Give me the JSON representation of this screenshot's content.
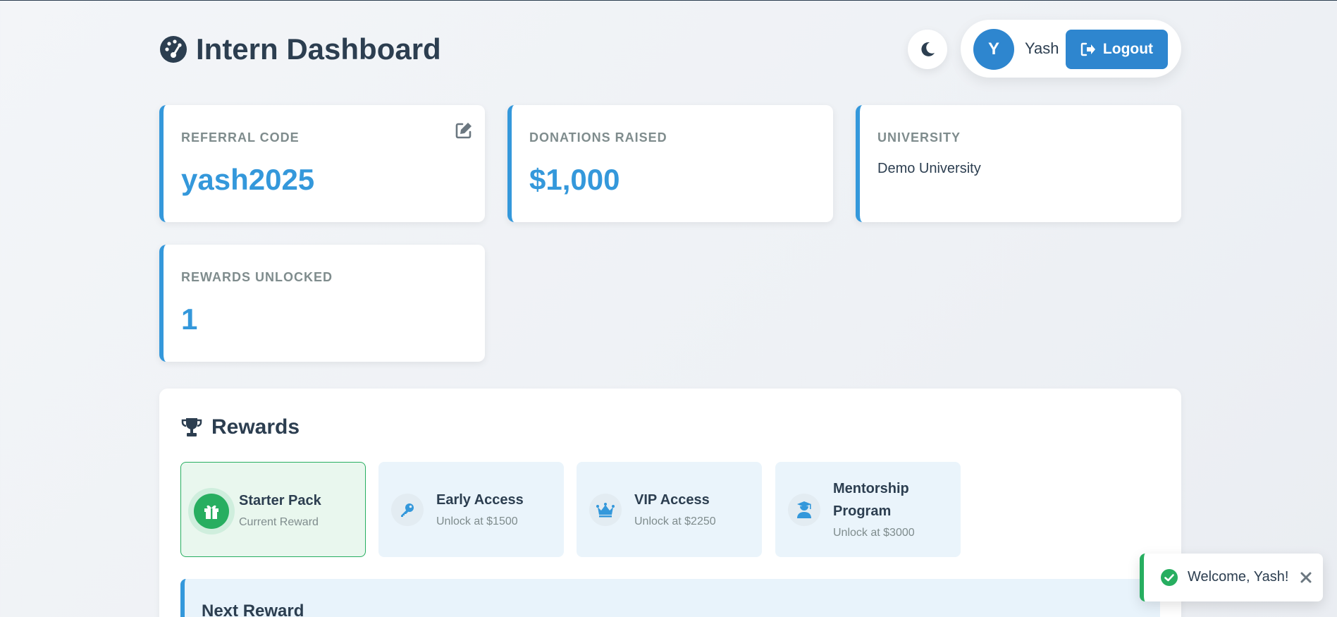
{
  "header": {
    "title": "Intern Dashboard",
    "title_icon": "tachometer-icon",
    "theme_toggle_icon": "moon-icon",
    "user": {
      "initial": "Y",
      "name": "Yash"
    },
    "logout_label": "Logout",
    "logout_icon": "sign-out-icon"
  },
  "stats": [
    {
      "label": "REFERRAL CODE",
      "value": "yash2025",
      "icon": "edit-icon"
    },
    {
      "label": "DONATIONS RAISED",
      "value": "$1,000"
    },
    {
      "label": "UNIVERSITY",
      "value": "Demo University"
    },
    {
      "label": "REWARDS UNLOCKED",
      "value": "1"
    }
  ],
  "rewards": {
    "title": "Rewards",
    "title_icon": "trophy-icon",
    "items": [
      {
        "name": "Starter Pack",
        "status": "Current Reward",
        "icon": "gift-icon"
      },
      {
        "name": "Early Access",
        "status": "Unlock at $1500",
        "icon": "key-icon"
      },
      {
        "name": "VIP Access",
        "status": "Unlock at $2250",
        "icon": "crown-icon"
      },
      {
        "name": "Mentorship Program",
        "status": "Unlock at $3000",
        "icon": "graduate-icon"
      }
    ],
    "next_reward_title": "Next Reward"
  },
  "toast": {
    "message": "Welcome, Yash!",
    "icon": "check-circle-icon",
    "close_icon": "close-icon"
  },
  "colors": {
    "accent": "#3498db",
    "primary_button": "#2e86cf",
    "success": "#27ae60",
    "text_dark": "#2c3e50",
    "text_muted": "#7f8c8d"
  }
}
